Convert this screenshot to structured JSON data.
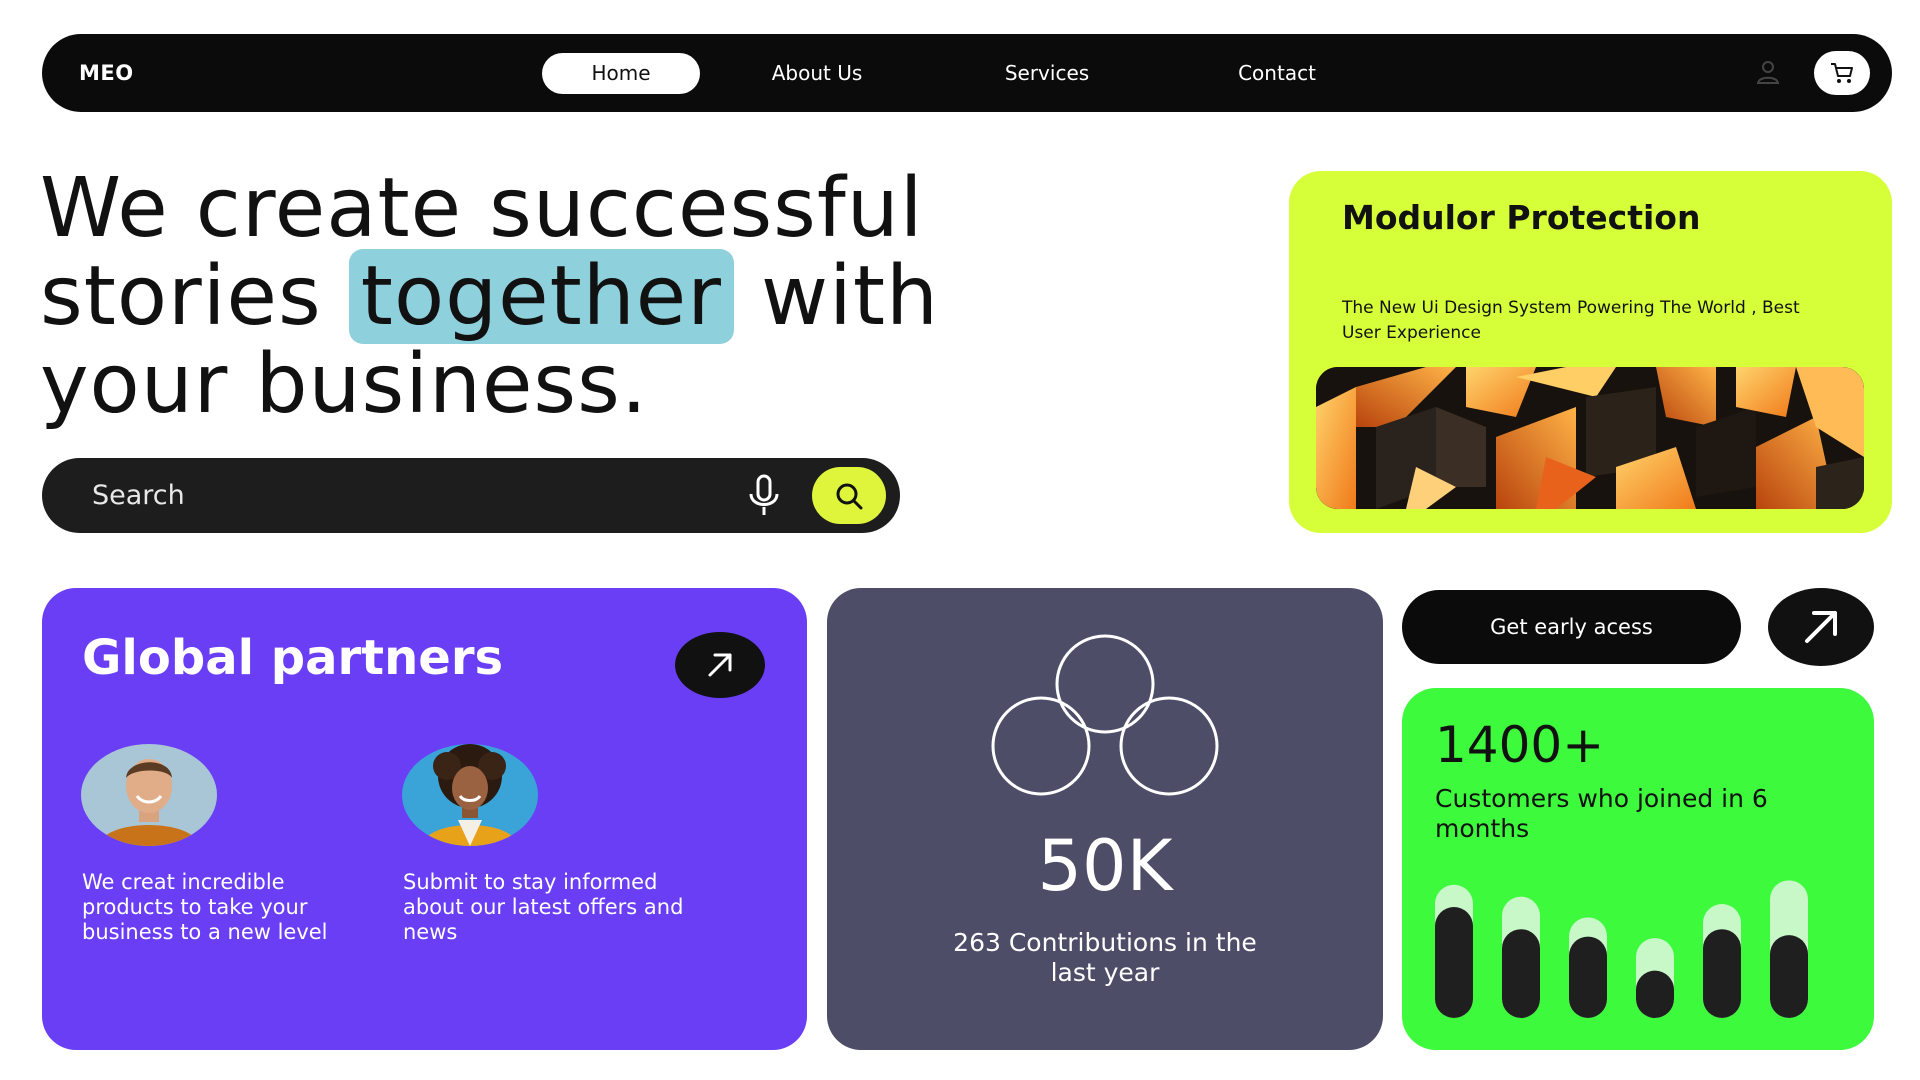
{
  "nav": {
    "logo": "MEO",
    "links": [
      {
        "label": "Home",
        "active": true
      },
      {
        "label": "About Us",
        "active": false
      },
      {
        "label": "Services",
        "active": false
      },
      {
        "label": "Contact",
        "active": false
      }
    ],
    "icons": {
      "user": "user-icon",
      "cart": "cart-icon"
    }
  },
  "hero": {
    "line1": "We create successful",
    "line2_before": "stories",
    "line2_highlight": "together",
    "line2_after": "with",
    "line3": "your business.",
    "highlight_color": "#8fd0dd"
  },
  "search": {
    "placeholder": "Search",
    "icons": {
      "mic": "microphone-icon",
      "search": "search-icon"
    }
  },
  "modulor": {
    "title": "Modulor Protection",
    "subtitle": "The New Ui Design System Powering  The World , Best User Experience",
    "image": "abstract-3d-cubes-image"
  },
  "partners": {
    "title": "Global partners",
    "items": [
      {
        "avatar": "smiling-man-avatar",
        "text": "We creat incredible products to take your business to a new level"
      },
      {
        "avatar": "curly-hair-woman-avatar",
        "text": "Submit to stay informed about our latest offers and news"
      }
    ],
    "icon": "arrow-up-right-icon"
  },
  "stats": {
    "value": "50K",
    "subtitle": "263 Contributions in the last year",
    "icon": "three-circles-icon"
  },
  "early_access": {
    "label": "Get early acess",
    "icon": "arrow-up-right-icon"
  },
  "customers": {
    "value": "1400+",
    "subtitle": "Customers who joined in 6 months",
    "bars": [
      {
        "total": 0.9,
        "filled": 0.75
      },
      {
        "total": 0.82,
        "filled": 0.6
      },
      {
        "total": 0.68,
        "filled": 0.55
      },
      {
        "total": 0.54,
        "filled": 0.32
      },
      {
        "total": 0.77,
        "filled": 0.6
      },
      {
        "total": 0.93,
        "filled": 0.56
      }
    ]
  },
  "colors": {
    "nav_bg": "#0b0b0b",
    "modulor_bg": "#d6ff3a",
    "search_button": "#dff53c",
    "partners_bg": "#6a3ef5",
    "stats_bg": "#4d4d68",
    "customers_bg": "#3dfa3d",
    "bar_fill": "#1f1f1f",
    "bar_track": "#c8f7c8"
  }
}
